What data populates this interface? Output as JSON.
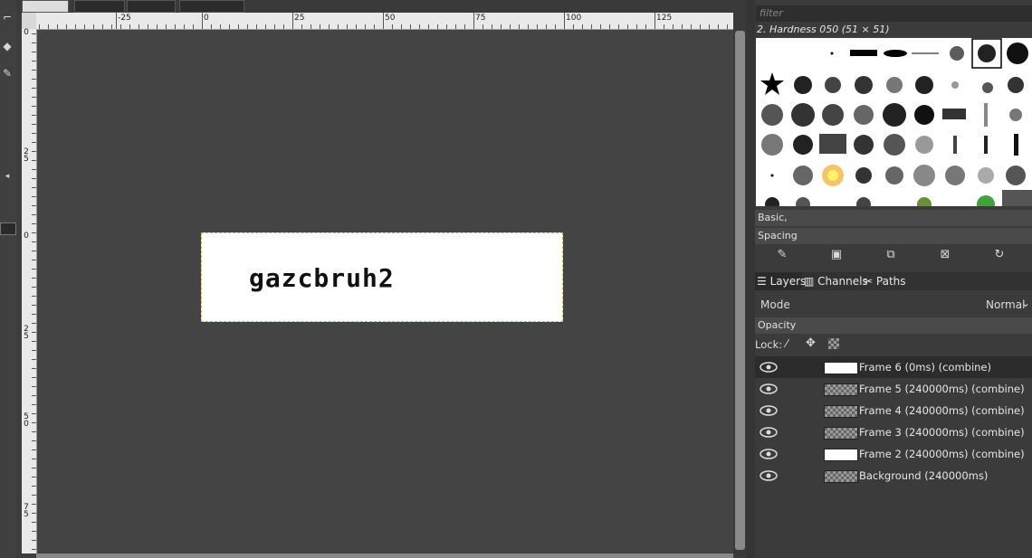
{
  "toolbox": {
    "icons": [
      "crop-icon",
      "eraser-icon",
      "smudge-icon"
    ]
  },
  "ruler": {
    "h_labels": [
      "-25",
      "0",
      "25",
      "50",
      "75",
      "100",
      "125"
    ],
    "v_labels": [
      "0",
      "2\n5",
      "0",
      "2\n5",
      "5\n0",
      "7\n5"
    ]
  },
  "image": {
    "text": "gazcbruh2"
  },
  "brushes": {
    "filter_placeholder": "filter",
    "title": "2. Hardness 050 (51 × 51)",
    "preset": "Basic,",
    "spacing_label": "Spacing"
  },
  "layers": {
    "tabs": [
      "Layers",
      "Channels",
      "Paths"
    ],
    "mode_label": "Mode",
    "mode_value": "Normal",
    "opacity_label": "Opacity",
    "lock_label": "Lock:",
    "items": [
      {
        "name": "Frame 6 (0ms) (combine)",
        "thumb": "white"
      },
      {
        "name": "Frame 5 (240000ms) (combine)",
        "thumb": "checker"
      },
      {
        "name": "Frame 4 (240000ms) (combine)",
        "thumb": "checker"
      },
      {
        "name": "Frame 3 (240000ms) (combine)",
        "thumb": "checker"
      },
      {
        "name": "Frame 2 (240000ms) (combine)",
        "thumb": "white"
      },
      {
        "name": "Background (240000ms)",
        "thumb": "checker"
      }
    ]
  },
  "colors": {
    "selection_border": "#d8c400",
    "canvas_bg": "#444444",
    "selected_layer_bg": "#2c2c2c"
  }
}
